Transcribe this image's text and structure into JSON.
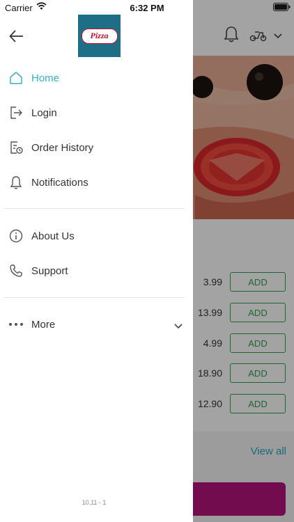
{
  "status_bar": {
    "carrier": "Carrier",
    "time": "6:32 PM"
  },
  "drawer": {
    "logo_text": "Pizza",
    "menu": [
      {
        "label": "Home",
        "icon": "home-icon",
        "active": true
      },
      {
        "label": "Login",
        "icon": "login-icon"
      },
      {
        "label": "Order History",
        "icon": "order-history-icon"
      },
      {
        "label": "Notifications",
        "icon": "bell-icon"
      },
      {
        "label": "About Us",
        "icon": "info-icon"
      },
      {
        "label": "Support",
        "icon": "phone-icon"
      },
      {
        "label": "More",
        "icon": "more-dots-icon"
      }
    ],
    "version": "10.11 - 1"
  },
  "background": {
    "prices": [
      "3.99",
      "13.99",
      "4.99",
      "18.90",
      "12.90"
    ],
    "add_label": "ADD",
    "view_all": "View all"
  },
  "colors": {
    "accent": "#34b3c6",
    "add_green": "#2f9e55",
    "cart_magenta": "#b3147a",
    "logo_bg": "#1f6e87"
  }
}
